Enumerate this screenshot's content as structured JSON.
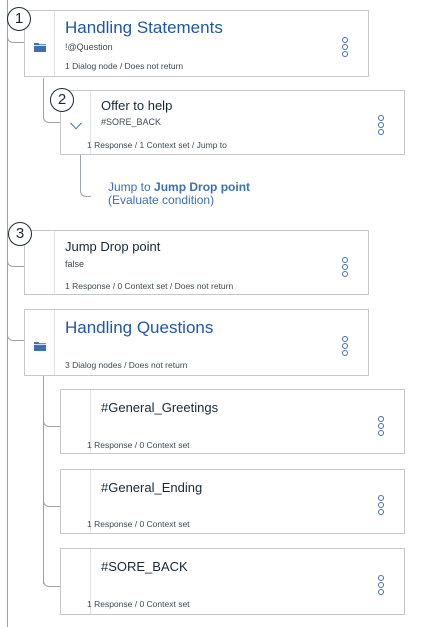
{
  "badges": [
    "1",
    "2",
    "3"
  ],
  "nodes": {
    "handling_statements": {
      "title": "Handling Statements",
      "condition": "!@Question",
      "meta": "1 Dialog node / Does not return"
    },
    "offer_to_help": {
      "title": "Offer to help",
      "condition": "#SORE_BACK",
      "meta": "1 Response / 1 Context set / Jump to"
    },
    "jump_drop_point": {
      "title": "Jump Drop point",
      "condition": "false",
      "meta": "1 Response / 0 Context set / Does not return"
    },
    "handling_questions": {
      "title": "Handling Questions",
      "meta": "3 Dialog nodes / Does not return"
    },
    "general_greetings": {
      "title": "#General_Greetings",
      "meta": "1 Response / 0 Context set"
    },
    "general_ending": {
      "title": "#General_Ending",
      "meta": "1 Response / 0 Context set"
    },
    "sore_back": {
      "title": "#SORE_BACK",
      "meta": "1 Response / 0 Context set"
    }
  },
  "jump": {
    "prefix": "Jump to ",
    "target": "Jump Drop point",
    "condition": "(Evaluate condition)"
  },
  "icons": {
    "folder": "folder-icon",
    "collapse": "chevron-down-icon",
    "menu": "overflow-menu-icon"
  },
  "colors": {
    "accent": "#3d70b2",
    "folder_title": "#1f57a4",
    "border": "#c7c7c7",
    "tree_line": "#9aa5ab"
  }
}
